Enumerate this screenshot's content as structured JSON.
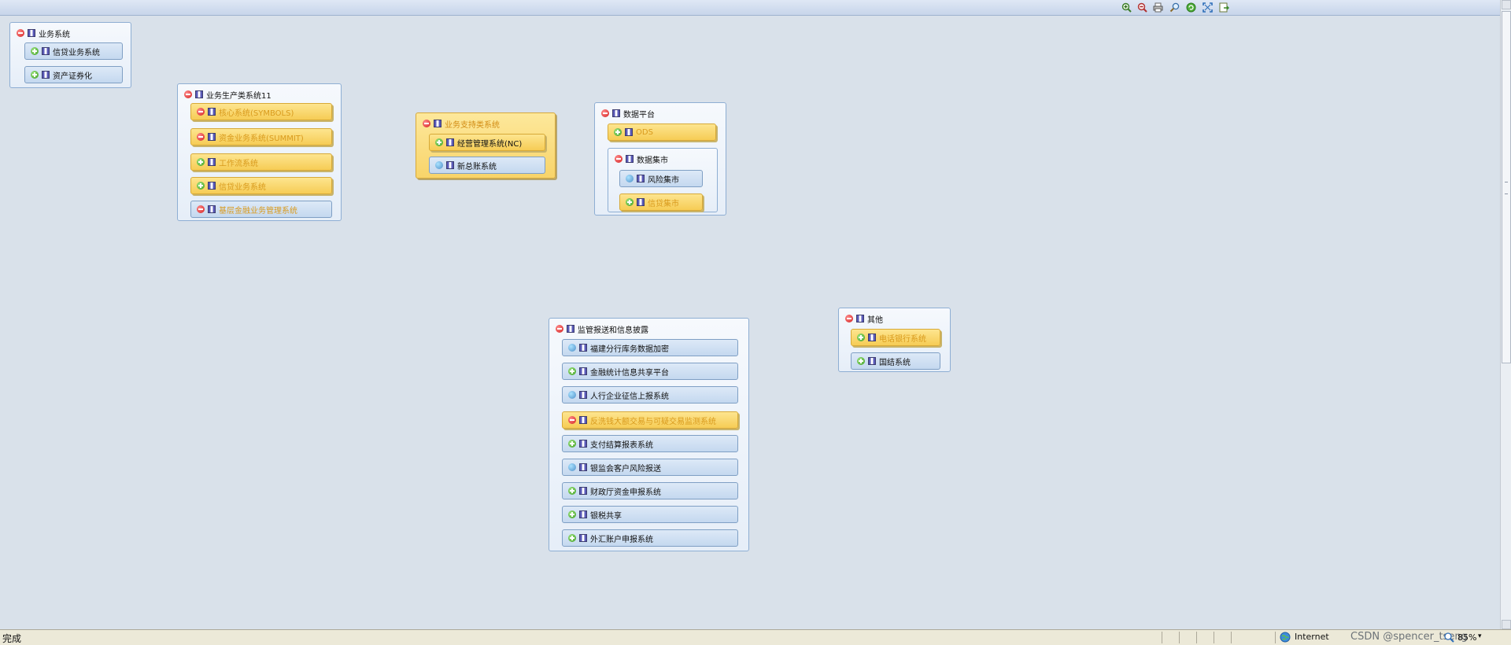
{
  "toolbar": {
    "buttons": [
      {
        "icon": "zoom-in-icon"
      },
      {
        "icon": "zoom-out-icon"
      },
      {
        "icon": "print-icon"
      },
      {
        "icon": "search-icon"
      },
      {
        "icon": "refresh-icon"
      },
      {
        "icon": "fit-screen-icon"
      },
      {
        "icon": "export-icon"
      }
    ]
  },
  "groups": {
    "g1": {
      "title": "业务系统",
      "title_toggle": "minus",
      "items": [
        {
          "label": "信贷业务系统",
          "toggle": "plus",
          "style": "blue"
        },
        {
          "label": "资产证券化",
          "toggle": "plus",
          "style": "blue"
        }
      ]
    },
    "g2": {
      "title": "业务生产类系统11",
      "title_toggle": "minus",
      "items": [
        {
          "label": "核心系统(SYMBOLS)",
          "toggle": "minus",
          "style": "yellow"
        },
        {
          "label": "资金业务系统(SUMMIT)",
          "toggle": "minus",
          "style": "yellow"
        },
        {
          "label": "工作流系统",
          "toggle": "plus",
          "style": "yellow"
        },
        {
          "label": "信贷业务系统",
          "toggle": "plus",
          "style": "yellow"
        },
        {
          "label": "基层金融业务管理系统",
          "toggle": "minus",
          "style": "blue"
        }
      ]
    },
    "g3": {
      "title": "业务支持类系统",
      "title_toggle": "minus",
      "items": [
        {
          "label": "经营管理系统(NC)",
          "toggle": "plus",
          "style": "yellow"
        },
        {
          "label": "新总账系统",
          "toggle": "link",
          "style": "blue"
        }
      ]
    },
    "g4": {
      "title": "数据平台",
      "title_toggle": "minus",
      "items": [
        {
          "label": "ODS",
          "toggle": "plus",
          "style": "yellow"
        }
      ],
      "sub": {
        "title": "数据集市",
        "title_toggle": "minus",
        "items": [
          {
            "label": "风险集市",
            "toggle": "link",
            "style": "blue"
          },
          {
            "label": "信贷集市",
            "toggle": "plus",
            "style": "yellow"
          }
        ]
      }
    },
    "g5": {
      "title": "监管报送和信息披露",
      "title_toggle": "minus",
      "items": [
        {
          "label": "福建分行库务数据加密",
          "toggle": "link",
          "style": "blue"
        },
        {
          "label": "金融统计信息共享平台",
          "toggle": "plus",
          "style": "blue"
        },
        {
          "label": "人行企业征信上报系统",
          "toggle": "link",
          "style": "blue"
        },
        {
          "label": "反洗钱大额交易与可疑交易监测系统",
          "toggle": "minus",
          "style": "yellow"
        },
        {
          "label": "支付结算报表系统",
          "toggle": "plus",
          "style": "blue"
        },
        {
          "label": "银监会客户风险报送",
          "toggle": "link",
          "style": "blue"
        },
        {
          "label": "财政厅资金申报系统",
          "toggle": "plus",
          "style": "blue"
        },
        {
          "label": "银税共享",
          "toggle": "plus",
          "style": "blue"
        },
        {
          "label": "外汇账户申报系统",
          "toggle": "plus",
          "style": "blue"
        }
      ]
    },
    "g6": {
      "title": "其他",
      "title_toggle": "minus",
      "items": [
        {
          "label": "电话银行系统",
          "toggle": "plus",
          "style": "yellow"
        },
        {
          "label": "国结系统",
          "toggle": "plus",
          "style": "blue"
        }
      ]
    }
  },
  "status": {
    "text": "完成",
    "zone": "Internet",
    "zoom": "85%",
    "zoom_dropdown": "▾",
    "credit": "CSDN @spencer_tseng"
  },
  "colors": {
    "canvas": "#d9e1ea",
    "group_border": "#8eaed3",
    "node_blue": "#c4d8ef",
    "node_yellow": "#f6cc55",
    "text_orange": "#d99a1c"
  }
}
